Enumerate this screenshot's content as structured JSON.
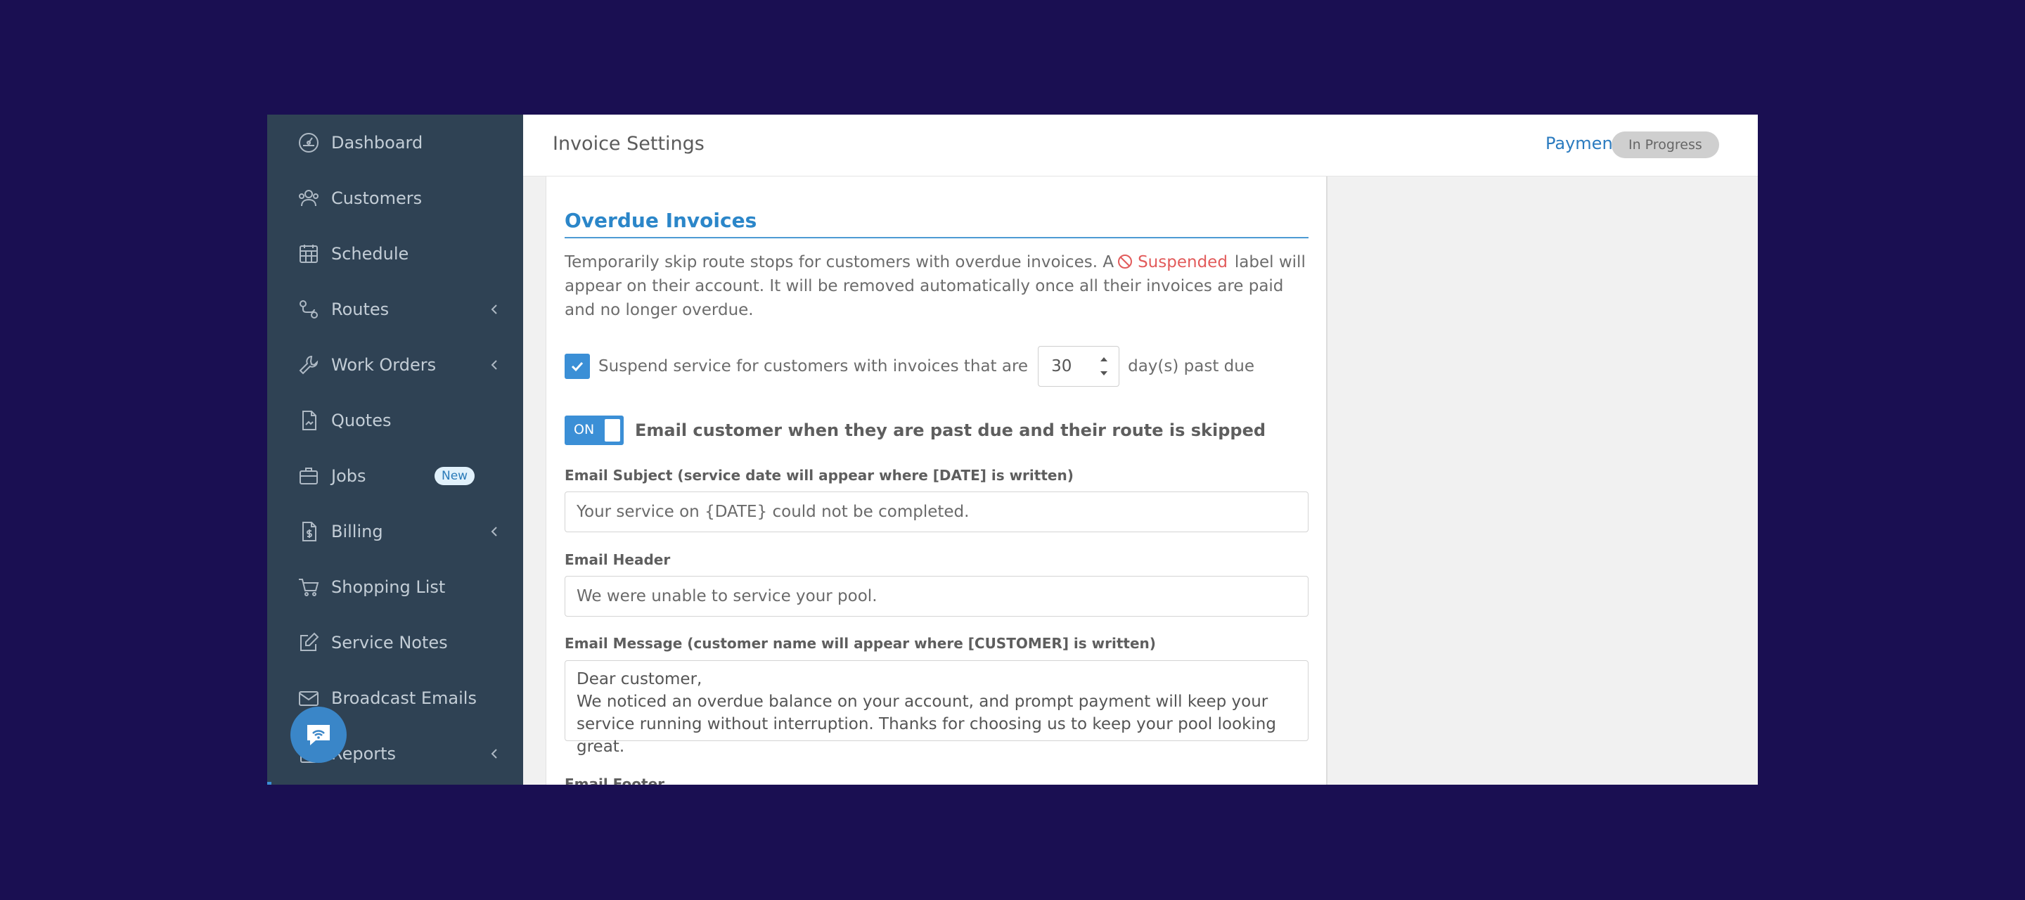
{
  "sidebar": {
    "items": [
      {
        "label": "Dashboard"
      },
      {
        "label": "Customers"
      },
      {
        "label": "Schedule"
      },
      {
        "label": "Routes"
      },
      {
        "label": "Work Orders"
      },
      {
        "label": "Quotes"
      },
      {
        "label": "Jobs",
        "badge": "New"
      },
      {
        "label": "Billing"
      },
      {
        "label": "Shopping List"
      },
      {
        "label": "Service Notes"
      },
      {
        "label": "Broadcast Emails"
      },
      {
        "label": "Reports"
      }
    ]
  },
  "header": {
    "title": "Invoice Settings",
    "payments_label": "Payments:",
    "payments_status": "In Progress"
  },
  "overdue": {
    "title": "Overdue Invoices",
    "desc_before": "Temporarily skip route stops for customers with overdue invoices. A",
    "suspended_label": "Suspended",
    "desc_after": "label will appear on their account. It will be removed automatically once all their invoices are paid and no longer overdue.",
    "suspend_text": "Suspend service for customers with invoices that are",
    "days_value": "30",
    "days_suffix": "day(s) past due",
    "toggle_label": "ON",
    "toggle_text": "Email customer when they are past due and their route is skipped",
    "subject_label": "Email Subject (service date will appear where [DATE] is written)",
    "subject_value": "Your service on {DATE} could not be completed.",
    "header_label": "Email Header",
    "header_value": "We were unable to service your pool.",
    "message_label": "Email Message (customer name will appear where [CUSTOMER] is written)",
    "message_line1": "Dear customer,",
    "message_line2": "We noticed an overdue balance on your account, and prompt payment will keep your service running without interruption. Thanks for choosing us to keep your pool looking great.",
    "footer_label": "Email Footer"
  },
  "colors": {
    "background": "#1a0f52",
    "sidebar": "#2f4254",
    "accent": "#3b8fd6",
    "suspended": "#e25b5b"
  }
}
